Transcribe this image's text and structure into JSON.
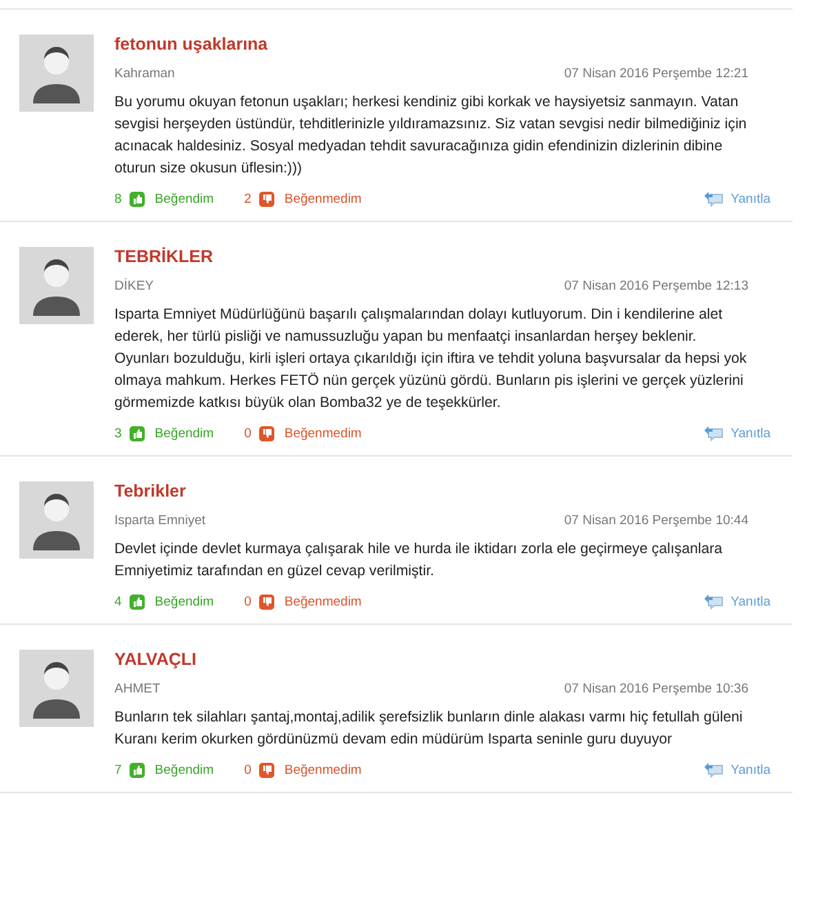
{
  "comments": [
    {
      "title": "fetonun uşaklarına",
      "author": "Kahraman",
      "date": "07 Nisan 2016 Perşembe 12:21",
      "body": "Bu yorumu okuyan fetonun uşakları; herkesi kendiniz gibi korkak ve haysiyetsiz sanmayın. Vatan sevgisi herşeyden üstündür, tehditlerinizle yıldıramazsınız. Siz vatan sevgisi nedir bilmediğiniz için acınacak haldesiniz. Sosyal medyadan tehdit savuracağınıza gidin efendinizin dizlerinin dibine oturun size okusun üflesin:)))",
      "likes": "8",
      "like_label": "Beğendim",
      "dislikes": "2",
      "dislike_label": "Beğenmedim",
      "reply": "Yanıtla"
    },
    {
      "title": "TEBRİKLER",
      "author": "DİKEY",
      "date": "07 Nisan 2016 Perşembe 12:13",
      "body": "Isparta Emniyet Müdürlüğünü başarılı çalışmalarından dolayı kutluyorum. Din i kendilerine alet ederek, her türlü pisliği ve namussuzluğu yapan bu menfaatçi insanlardan herşey beklenir. Oyunları bozulduğu, kirli işleri ortaya çıkarıldığı için iftira ve tehdit yoluna başvursalar da hepsi yok olmaya mahkum. Herkes FETÖ nün gerçek yüzünü gördü. Bunların pis işlerini ve gerçek yüzlerini görmemizde katkısı büyük olan Bomba32 ye de teşekkürler.",
      "likes": "3",
      "like_label": "Beğendim",
      "dislikes": "0",
      "dislike_label": "Beğenmedim",
      "reply": "Yanıtla"
    },
    {
      "title": "Tebrikler",
      "author": "Isparta Emniyet",
      "date": "07 Nisan 2016 Perşembe 10:44",
      "body": "Devlet içinde devlet kurmaya çalışarak hile ve hurda ile iktidarı zorla ele geçirmeye çalışanlara Emniyetimiz tarafından en güzel cevap verilmiştir.",
      "likes": "4",
      "like_label": "Beğendim",
      "dislikes": "0",
      "dislike_label": "Beğenmedim",
      "reply": "Yanıtla"
    },
    {
      "title": "YALVAÇLI",
      "author": "AHMET",
      "date": "07 Nisan 2016 Perşembe 10:36",
      "body": "Bunların tek silahları şantaj,montaj,adilik şerefsizlik bunların dinle alakası varmı hiç fetullah güleni Kuranı kerim okurken gördünüzmü devam edin müdürüm Isparta seninle guru duyuyor",
      "likes": "7",
      "like_label": "Beğendim",
      "dislikes": "0",
      "dislike_label": "Beğenmedim",
      "reply": "Yanıtla"
    }
  ]
}
